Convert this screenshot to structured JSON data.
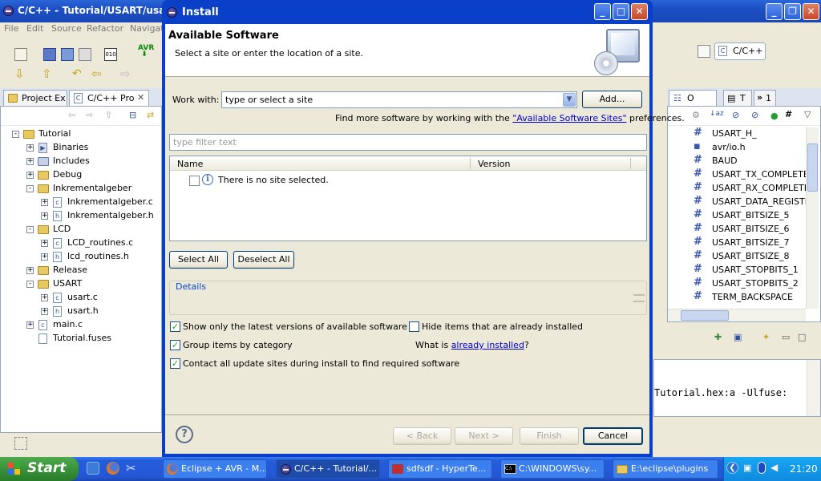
{
  "window": {
    "title": "C/C++ - Tutorial/USART/usart.h"
  },
  "menu": [
    "File",
    "Edit",
    "Source",
    "Refactor",
    "Navigate"
  ],
  "perspective": {
    "label": "C/C++"
  },
  "left_view": {
    "tabs": [
      "Project Ex",
      "C/C++ Pro"
    ],
    "tree": [
      {
        "label": "Tutorial",
        "kind": "project",
        "indent": 0,
        "expander": "-"
      },
      {
        "label": "Binaries",
        "kind": "binary",
        "indent": 1,
        "expander": "+"
      },
      {
        "label": "Includes",
        "kind": "includes",
        "indent": 1,
        "expander": "+"
      },
      {
        "label": "Debug",
        "kind": "folder",
        "indent": 1,
        "expander": "+"
      },
      {
        "label": "Inkrementalgeber",
        "kind": "folder",
        "indent": 1,
        "expander": "-"
      },
      {
        "label": "Inkrementalgeber.c",
        "kind": "c",
        "indent": 2,
        "expander": "+"
      },
      {
        "label": "Inkrementalgeber.h",
        "kind": "h",
        "indent": 2,
        "expander": "+"
      },
      {
        "label": "LCD",
        "kind": "folder",
        "indent": 1,
        "expander": "-"
      },
      {
        "label": "LCD_routines.c",
        "kind": "c",
        "indent": 2,
        "expander": "+"
      },
      {
        "label": "lcd_routines.h",
        "kind": "h",
        "indent": 2,
        "expander": "+"
      },
      {
        "label": "Release",
        "kind": "folder",
        "indent": 1,
        "expander": "+"
      },
      {
        "label": "USART",
        "kind": "folder",
        "indent": 1,
        "expander": "-"
      },
      {
        "label": "usart.c",
        "kind": "c",
        "indent": 2,
        "expander": "+"
      },
      {
        "label": "usart.h",
        "kind": "h",
        "indent": 2,
        "expander": "+"
      },
      {
        "label": "main.c",
        "kind": "c",
        "indent": 1,
        "expander": "+"
      },
      {
        "label": "Tutorial.fuses",
        "kind": "file",
        "indent": 1,
        "expander": ""
      }
    ]
  },
  "outline": {
    "tabs": [
      "O",
      "T",
      "1"
    ],
    "items": [
      "USART_H_",
      "avr/io.h",
      "BAUD",
      "USART_TX_COMPLETE_",
      "USART_RX_COMPLETE_",
      "USART_DATA_REGISTE",
      "USART_BITSIZE_5",
      "USART_BITSIZE_6",
      "USART_BITSIZE_7",
      "USART_BITSIZE_8",
      "USART_STOPBITS_1",
      "USART_STOPBITS_2",
      "TERM_BACKSPACE"
    ]
  },
  "console": {
    "line": "Tutorial.hex:a -Ulfuse:"
  },
  "dialog": {
    "title": "Install",
    "heading": "Available Software",
    "subheading": "Select a site or enter the location of a site.",
    "work_with_label": "Work with:",
    "work_with_value": "type or select a site",
    "add_button": "Add...",
    "find_more_prefix": "Find more software by working with the ",
    "find_more_link": "\"Available Software Sites\"",
    "find_more_suffix": " preferences.",
    "filter_placeholder": "type filter text",
    "columns": [
      "Name",
      "Version"
    ],
    "empty_message": "There is no site selected.",
    "select_all": "Select All",
    "deselect_all": "Deselect All",
    "details_label": "Details",
    "options": [
      {
        "label": "Show only the latest versions of available software",
        "checked": true
      },
      {
        "label": "Group items by category",
        "checked": true
      },
      {
        "label": "Contact all update sites during install to find required software",
        "checked": true
      }
    ],
    "hide_installed": {
      "label": "Hide items that are already installed",
      "checked": false
    },
    "what_is_prefix": "What is ",
    "what_is_link": "already installed",
    "what_is_suffix": "?",
    "back_button": "< Back",
    "next_button": "Next >",
    "finish_button": "Finish",
    "cancel_button": "Cancel"
  },
  "taskbar": {
    "start_label": "Start",
    "tasks": [
      "Eclipse + AVR - M...",
      "C/C++ - Tutorial/...",
      "sdfsdf - HyperTe...",
      "C:\\WINDOWS\\sy...",
      "E:\\eclipse\\plugins"
    ],
    "clock": "21:20"
  }
}
